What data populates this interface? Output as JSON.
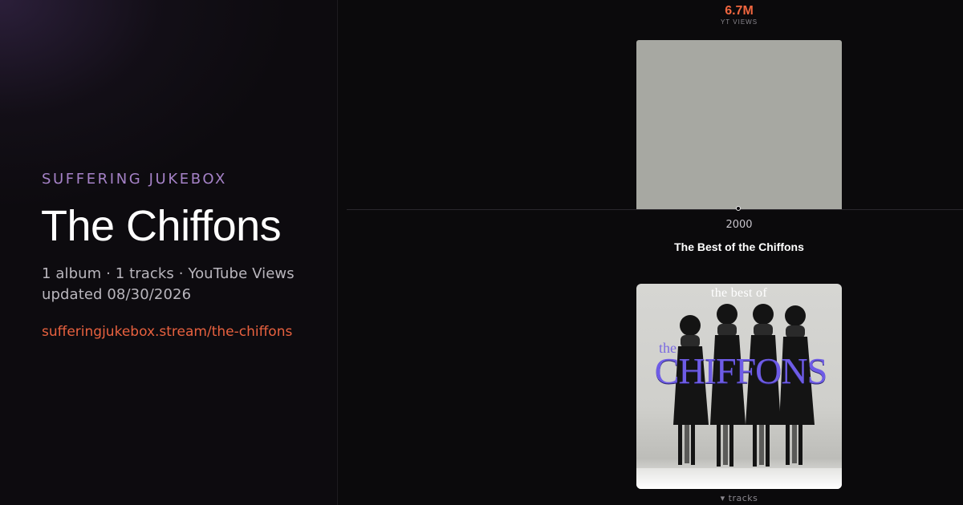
{
  "site": {
    "brand": "SUFFERING JUKEBOX",
    "url": "sufferingjukebox.stream/the-chiffons"
  },
  "artist": {
    "name": "The Chiffons",
    "summary": "1 album · 1 tracks · YouTube Views",
    "updated": "updated 08/30/2026"
  },
  "timeline": {
    "metric_label": "YT VIEWS",
    "albums": [
      {
        "views_display": "6.7M",
        "views": 6700000,
        "year": "2000",
        "title": "The Best of the Chiffons",
        "cover": {
          "line_top": "the best of",
          "line_small": "the",
          "line_main": "CHIFFONS"
        },
        "tracks_toggle": "▾ tracks"
      }
    ]
  },
  "colors": {
    "accent": "#e8613f",
    "brand": "#a582c7",
    "bar": "#a7a8a2",
    "background": "#0b0a0c"
  }
}
